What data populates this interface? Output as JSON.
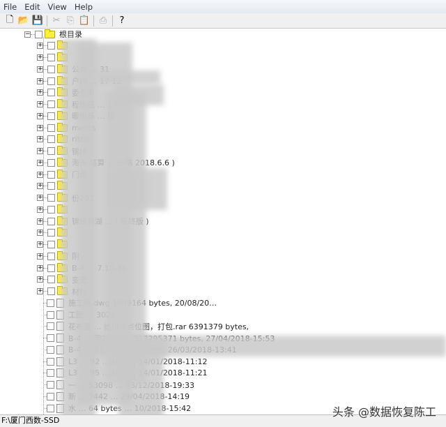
{
  "menu": [
    "File",
    "Edit",
    "View",
    "Help"
  ],
  "toolbar": [
    {
      "icon": "new-file-icon",
      "glyph": "🗋",
      "enabled": true
    },
    {
      "icon": "open-folder-icon",
      "glyph": "📂",
      "enabled": true
    },
    {
      "icon": "save-icon",
      "glyph": "💾",
      "enabled": true
    },
    {
      "sep": true
    },
    {
      "icon": "cut-icon",
      "glyph": "✂",
      "enabled": false
    },
    {
      "icon": "copy-icon",
      "glyph": "⎘",
      "enabled": false
    },
    {
      "icon": "paste-icon",
      "glyph": "📋",
      "enabled": false
    },
    {
      "sep": true
    },
    {
      "icon": "print-icon",
      "glyph": "⎙",
      "enabled": false
    },
    {
      "sep": true
    },
    {
      "icon": "help-icon",
      "glyph": "?",
      "enabled": true
    }
  ],
  "tree": {
    "root": "根目录",
    "folders": [
      "",
      "",
      "公共 … 31",
      "户内 … 17 12",
      "委会审",
      "程图纸 … 1",
      "暖电基 … 版",
      "ments",
      "rites",
      "锦绣",
      "海天 结算 … 出稿 2018.6.6 )",
      "门诶",
      "",
      "份201",
      "",
      "锦绣碧湖 … ( 最终版 )",
      "",
      "",
      "阴",
      "B-4 … 7.10.31",
      "变更",
      "材料"
    ],
    "files": [
      "施工图.dwg   1049164 bytes, 20/08/20…",
      "工图 … 3028",
      "花布置 … 给排水点位图，打包.rar   6391379 bytes,",
      "B-4 … 图2017 … 317295371 bytes, 27/04/2018-15:53",
      "B-4 … 03.rar … 28 bytes, 26/03/2018-13:41",
      "L3 … 92 … bytes, 14/01/2018-11:12",
      "L3 … 95 … bytes, 14/01/2018-11:21",
      "一 … 53098 … 03/12/2018-19:33",
      "新 … 7442 … 29/04/2018-14:19",
      "水 … 64 bytes … 10/2018-15:42"
    ]
  },
  "status": "F:\\厦门西数-SSD",
  "watermark": "头条 @数据恢复陈工"
}
